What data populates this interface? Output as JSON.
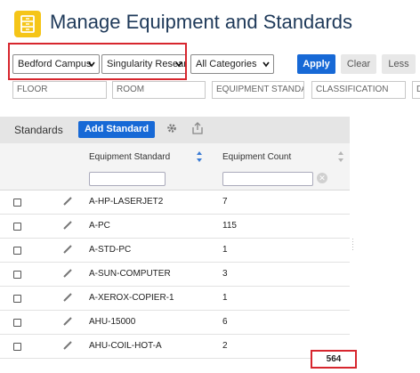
{
  "header": {
    "title": "Manage Equipment and Standards",
    "icon": "equipment-cabinet-icon",
    "icon_color": "#f5c518"
  },
  "filters": {
    "site": "Bedford Campus",
    "building": "Singularity Research",
    "category": "All Categories",
    "apply_label": "Apply",
    "clear_label": "Clear",
    "less_label": "Less",
    "floor_placeholder": "FLOOR",
    "room_placeholder": "ROOM",
    "equipment_standard_placeholder": "EQUIPMENT STANDARD",
    "classification_placeholder": "CLASSIFICATION",
    "extra_placeholder": "D"
  },
  "panel": {
    "title": "Standards",
    "add_label": "Add Standard",
    "settings_icon": "gear-icon",
    "export_icon": "export-icon"
  },
  "table": {
    "columns": [
      "Equipment Standard",
      "Equipment Count"
    ],
    "rows": [
      {
        "standard": "A-HP-LASERJET2",
        "count": "7"
      },
      {
        "standard": "A-PC",
        "count": "115"
      },
      {
        "standard": "A-STD-PC",
        "count": "1"
      },
      {
        "standard": "A-SUN-COMPUTER",
        "count": "3"
      },
      {
        "standard": "A-XEROX-COPIER-1",
        "count": "1"
      },
      {
        "standard": "AHU-15000",
        "count": "6"
      },
      {
        "standard": "AHU-COIL-HOT-A",
        "count": "2"
      }
    ],
    "total": "564"
  },
  "colors": {
    "accent": "#1769d6",
    "highlight": "#d7262e",
    "title": "#1f3a5a"
  }
}
